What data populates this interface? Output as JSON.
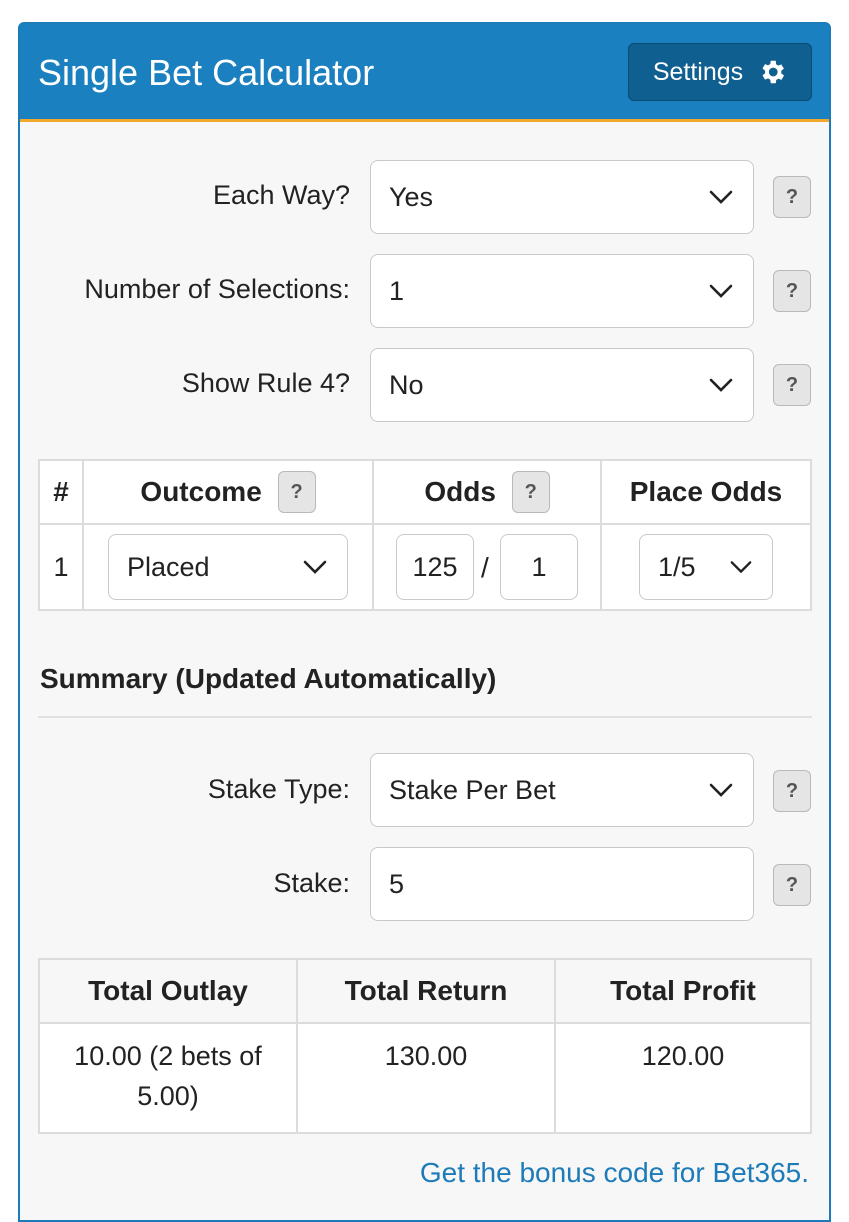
{
  "header": {
    "title": "Single Bet Calculator",
    "settings_label": "Settings"
  },
  "form": {
    "each_way": {
      "label": "Each Way?",
      "value": "Yes"
    },
    "selections": {
      "label": "Number of Selections:",
      "value": "1"
    },
    "rule4": {
      "label": "Show Rule 4?",
      "value": "No"
    }
  },
  "help_label": "?",
  "selections_table": {
    "headers": {
      "num": "#",
      "outcome": "Outcome",
      "odds": "Odds",
      "place_odds": "Place Odds"
    },
    "row": {
      "num": "1",
      "outcome": "Placed",
      "odds_num": "125",
      "odds_sep": "/",
      "odds_den": "1",
      "place_odds": "1/5"
    }
  },
  "summary": {
    "title": "Summary (Updated Automatically)",
    "stake_type": {
      "label": "Stake Type:",
      "value": "Stake Per Bet"
    },
    "stake": {
      "label": "Stake:",
      "value": "5"
    }
  },
  "totals": {
    "headers": {
      "outlay": "Total Outlay",
      "return": "Total Return",
      "profit": "Total Profit"
    },
    "values": {
      "outlay": "10.00 (2 bets of 5.00)",
      "return": "130.00",
      "profit": "120.00"
    }
  },
  "footer": {
    "bonus_link": "Get the bonus code for Bet365."
  },
  "colors": {
    "header": "#1a80bf",
    "accent": "#f0a92a",
    "link": "#1c7bb8"
  }
}
